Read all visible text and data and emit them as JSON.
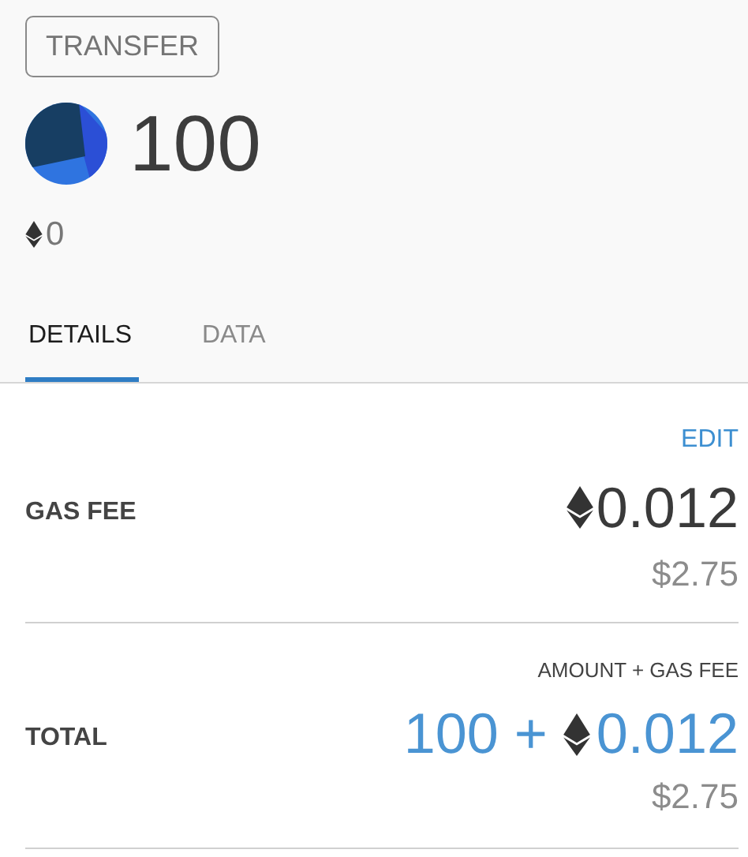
{
  "header": {
    "badge": "TRANSFER",
    "amount": "100",
    "eth_amount": "0"
  },
  "tabs": [
    {
      "label": "DETAILS",
      "selected": true
    },
    {
      "label": "DATA",
      "selected": false
    }
  ],
  "gas_fee": {
    "edit": "EDIT",
    "label": "GAS FEE",
    "eth": "0.012",
    "fiat": "$2.75"
  },
  "total": {
    "caption": "AMOUNT + GAS FEE",
    "label": "TOTAL",
    "amount": "100 +",
    "eth": "0.012",
    "fiat": "$2.75"
  }
}
